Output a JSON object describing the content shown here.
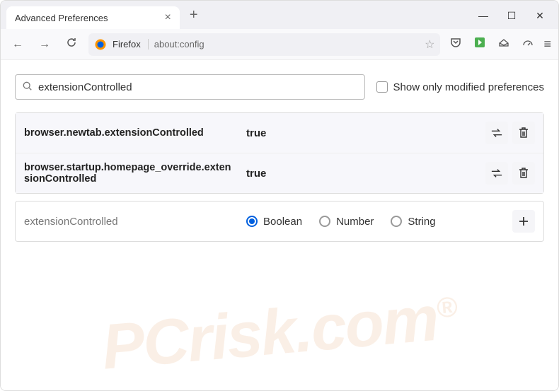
{
  "tab": {
    "title": "Advanced Preferences"
  },
  "urlbar": {
    "identity": "Firefox",
    "url": "about:config"
  },
  "search": {
    "value": "extensionControlled",
    "checkbox_label": "Show only modified preferences"
  },
  "prefs": [
    {
      "name": "browser.newtab.extensionControlled",
      "value": "true"
    },
    {
      "name": "browser.startup.homepage_override.extensionControlled",
      "value": "true"
    }
  ],
  "new_pref": {
    "name": "extensionControlled",
    "types": [
      "Boolean",
      "Number",
      "String"
    ],
    "selected": 0
  },
  "watermark": "PCrisk.com"
}
